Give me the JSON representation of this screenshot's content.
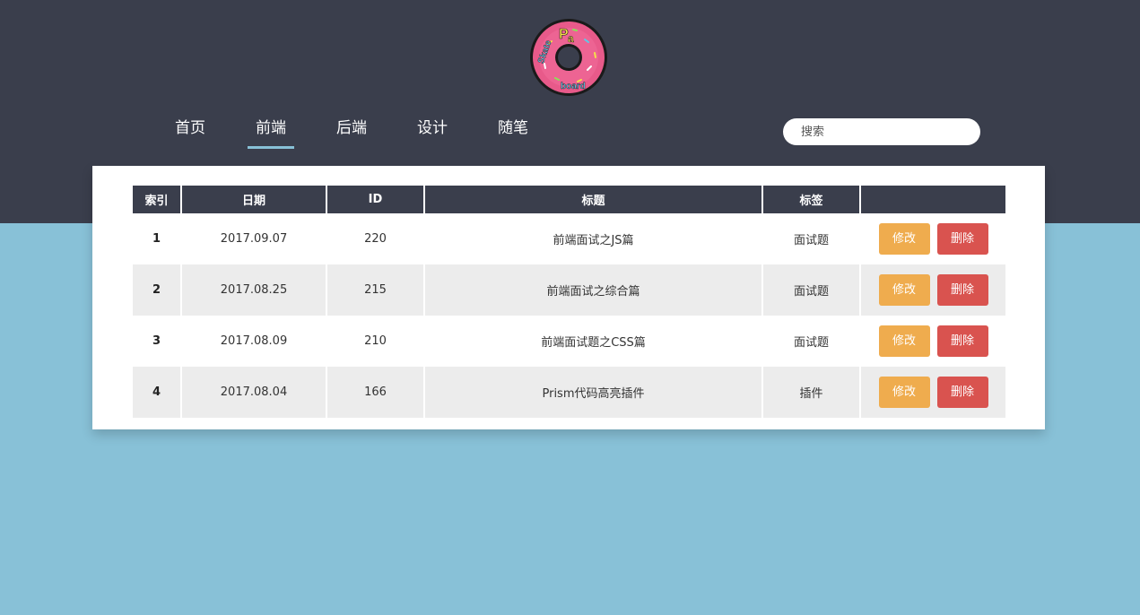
{
  "logo": {
    "text": "Pay Skateboard",
    "icon": "donut-logo"
  },
  "nav": {
    "items": [
      {
        "label": "首页"
      },
      {
        "label": "前端"
      },
      {
        "label": "后端"
      },
      {
        "label": "设计"
      },
      {
        "label": "随笔"
      }
    ],
    "active_index": 1
  },
  "search": {
    "placeholder": "搜索",
    "value": ""
  },
  "table": {
    "headers": [
      "索引",
      "日期",
      "ID",
      "标题",
      "标签",
      ""
    ],
    "rows": [
      {
        "index": "1",
        "date": "2017.09.07",
        "id": "220",
        "title": "前端面试之JS篇",
        "tag": "面试题",
        "edit": "修改",
        "delete": "删除"
      },
      {
        "index": "2",
        "date": "2017.08.25",
        "id": "215",
        "title": "前端面试之综合篇",
        "tag": "面试题",
        "edit": "修改",
        "delete": "删除"
      },
      {
        "index": "3",
        "date": "2017.08.09",
        "id": "210",
        "title": "前端面试题之CSS篇",
        "tag": "面试题",
        "edit": "修改",
        "delete": "删除"
      },
      {
        "index": "4",
        "date": "2017.08.04",
        "id": "166",
        "title": "Prism代码高亮插件",
        "tag": "插件",
        "edit": "修改",
        "delete": "删除"
      }
    ]
  },
  "colors": {
    "header_bg": "#3a3e4c",
    "page_bg": "#88c1d7",
    "edit_button": "#efac4e",
    "delete_button": "#d9534f",
    "active_underline": "#88c1d7"
  }
}
